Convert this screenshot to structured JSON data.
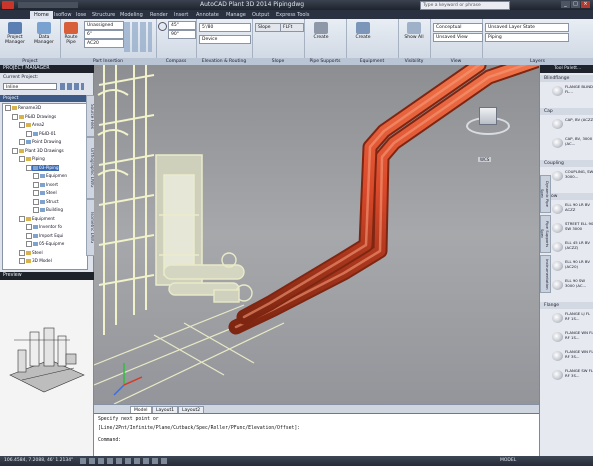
{
  "window": {
    "title": "AutoCAD Plant 3D 2014  Pipingdwg",
    "search_placeholder": "Type a keyword or phrase"
  },
  "ribbon_tabs": [
    {
      "label": "Home",
      "active": true
    },
    {
      "label": "Isoflow"
    },
    {
      "label": "Iose"
    },
    {
      "label": "Structure"
    },
    {
      "label": "Modeling"
    },
    {
      "label": "Render"
    },
    {
      "label": "Insert"
    },
    {
      "label": "Annotate"
    },
    {
      "label": "Manage"
    },
    {
      "label": "Output"
    },
    {
      "label": "Express Tools"
    }
  ],
  "ribbon": {
    "project_panel": {
      "title": "Project",
      "project_manager": "Project Manager",
      "data_manager": "Data Manager"
    },
    "part_insertion": {
      "title": "Part Insertion",
      "route_pipe": "Route Pipe",
      "spec": "Unassigned",
      "size": "6\"",
      "material": "AC20"
    },
    "compass": {
      "title": "Compass",
      "angle1": "45°",
      "angle2": "90°"
    },
    "elevation": {
      "title": "Elevation & Routing",
      "value": "5'/80",
      "device": "Device"
    },
    "slope": {
      "title": "Slope",
      "value": "Slope",
      "flip": "FLFt"
    },
    "pipe_supports": {
      "title": "Pipe Supports",
      "create": "Create"
    },
    "equipment": {
      "title": "Equipment",
      "create": "Create"
    },
    "visibility": {
      "title": "Visibility",
      "show_all": "Show All"
    },
    "view": {
      "title": "View",
      "style": "Conceptual",
      "saved": "Unsaved View"
    },
    "layers": {
      "title": "Layers",
      "state": "Unsaved Layer State",
      "layer": "Piping"
    }
  },
  "project_manager": {
    "title": "PROJECT MANAGER",
    "current_project_label": "Current Project:",
    "current_project": "Inline",
    "project_header": "Project",
    "tree": [
      {
        "label": "Rename3D",
        "depth": 0,
        "type": "folder"
      },
      {
        "label": "P&ID Drawings",
        "depth": 1,
        "type": "folder"
      },
      {
        "label": "Area2",
        "depth": 2,
        "type": "folder"
      },
      {
        "label": "P&ID-01",
        "depth": 3,
        "type": "file"
      },
      {
        "label": "Point Drawing",
        "depth": 2,
        "type": "file"
      },
      {
        "label": "Plant 3D Drawings",
        "depth": 1,
        "type": "folder"
      },
      {
        "label": "Piping",
        "depth": 2,
        "type": "folder"
      },
      {
        "label": "03-Piping",
        "depth": 3,
        "type": "file",
        "selected": true
      },
      {
        "label": "Equipmen",
        "depth": 4,
        "type": "file"
      },
      {
        "label": "Insert",
        "depth": 4,
        "type": "file"
      },
      {
        "label": "Steel",
        "depth": 4,
        "type": "file"
      },
      {
        "label": "Struct",
        "depth": 4,
        "type": "file"
      },
      {
        "label": "Building",
        "depth": 4,
        "type": "file"
      },
      {
        "label": "Equipment",
        "depth": 2,
        "type": "folder"
      },
      {
        "label": "Inventor fo",
        "depth": 3,
        "type": "file"
      },
      {
        "label": "Import Equi",
        "depth": 3,
        "type": "file"
      },
      {
        "label": "05-Equipme",
        "depth": 3,
        "type": "file"
      },
      {
        "label": "Steel",
        "depth": 2,
        "type": "folder"
      },
      {
        "label": "3D Model",
        "depth": 2,
        "type": "folder"
      }
    ],
    "side_tabs": [
      "Source Files",
      "Orthographic DWG",
      "Isometric DWG"
    ]
  },
  "preview": {
    "title": "Preview"
  },
  "viewport": {
    "label": "Model",
    "viewcube_face": "LEFT",
    "viewcube_compass": "WCS"
  },
  "layout_tabs": [
    "Model",
    "Layout1",
    "Layout2"
  ],
  "command_line": {
    "line1": "Specify next point or",
    "line2": "[Line/2Pnt/Infinite/Plane/Cutback/Spec/Roller/PFunc/Elevation/Offset]:",
    "prompt": "Command:"
  },
  "status_bar": {
    "coords": "106.4584, 7.2088, 46' 1.2134\"",
    "model": "MODEL"
  },
  "tool_palette": {
    "title": "Tool Palett...",
    "tabs": [
      "Dynamic Pipe Spec",
      "Pipe Supports Spec",
      "Instrumentation"
    ],
    "sections": [
      {
        "name": "Blindflange",
        "items": [
          {
            "label": "FLANGE BLIND FL..."
          }
        ]
      },
      {
        "name": "Cap",
        "items": [
          {
            "label": "CAP, BV (ACZZ)"
          },
          {
            "label": "CAP, BV, 3000 (AC..."
          }
        ]
      },
      {
        "name": "Coupling",
        "items": [
          {
            "label": "COUPLING, SW, 3000..."
          }
        ]
      },
      {
        "name": "Elbow",
        "items": [
          {
            "label": "ELL 90 LR BV ACZZ"
          },
          {
            "label": "STREET ELL 90 SW 3000"
          },
          {
            "label": "ELL 45 LR BV (ACZZ)"
          },
          {
            "label": "ELL 90 LR BV (AC20)"
          },
          {
            "label": "ELL 90 SW 3000 (AC..."
          }
        ]
      },
      {
        "name": "Flange",
        "items": [
          {
            "label": "FLANGE LJ FL RF 1S..."
          },
          {
            "label": "FLANGE WN FL RF 1S..."
          },
          {
            "label": "FLANGE WN FL RF 3S..."
          },
          {
            "label": "FLANGE SW FL RF 3S..."
          }
        ]
      }
    ]
  },
  "colors": {
    "pipe": "#e2542a",
    "pipe_dark": "#8c2a14",
    "structure": "#eef0c6",
    "viewport_bg": "#9a9c9f"
  }
}
